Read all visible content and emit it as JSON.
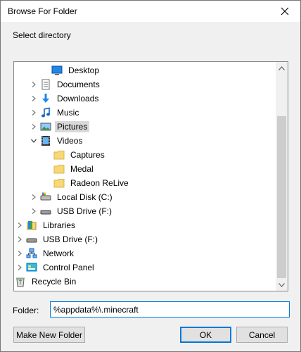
{
  "dialog": {
    "title": "Browse For Folder",
    "prompt": "Select directory"
  },
  "tree": {
    "items": [
      {
        "label": "Desktop",
        "icon": "desktop-icon",
        "expander": "none"
      },
      {
        "label": "Documents",
        "icon": "documents-icon",
        "expander": "collapsed"
      },
      {
        "label": "Downloads",
        "icon": "downloads-icon",
        "expander": "collapsed"
      },
      {
        "label": "Music",
        "icon": "music-icon",
        "expander": "collapsed"
      },
      {
        "label": "Pictures",
        "icon": "pictures-icon",
        "expander": "collapsed",
        "selected": true
      },
      {
        "label": "Videos",
        "icon": "videos-icon",
        "expander": "expanded"
      },
      {
        "label": "Captures",
        "icon": "folder-icon",
        "expander": "none"
      },
      {
        "label": "Medal",
        "icon": "folder-icon",
        "expander": "none"
      },
      {
        "label": "Radeon ReLive",
        "icon": "folder-icon",
        "expander": "none"
      },
      {
        "label": "Local Disk (C:)",
        "icon": "local-disk-icon",
        "expander": "collapsed"
      },
      {
        "label": "USB Drive (F:)",
        "icon": "usb-drive-icon",
        "expander": "collapsed"
      },
      {
        "label": "Libraries",
        "icon": "libraries-icon",
        "expander": "collapsed"
      },
      {
        "label": "USB Drive (F:)",
        "icon": "usb-drive-icon",
        "expander": "collapsed"
      },
      {
        "label": "Network",
        "icon": "network-icon",
        "expander": "collapsed"
      },
      {
        "label": "Control Panel",
        "icon": "control-panel-icon",
        "expander": "collapsed"
      },
      {
        "label": "Recycle Bin",
        "icon": "recycle-bin-icon",
        "expander": "none"
      }
    ]
  },
  "folder": {
    "label": "Folder:",
    "value": "%appdata%\\.minecraft"
  },
  "buttons": {
    "new_folder": "Make New Folder",
    "ok": "OK",
    "cancel": "Cancel"
  },
  "colors": {
    "accent": "#0078d7",
    "selection": "#d9d9d9",
    "folder": "#f8d775"
  }
}
